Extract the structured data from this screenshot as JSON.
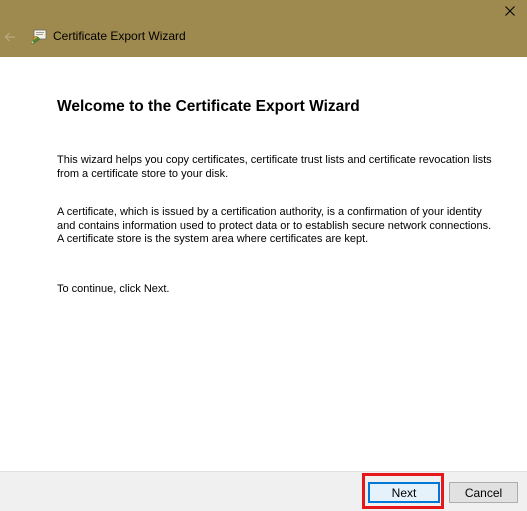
{
  "window": {
    "title": "Certificate Export Wizard",
    "titlebar_color": "#9e8a4f"
  },
  "icons": {
    "close": "close-icon",
    "back": "back-arrow-icon",
    "wizard": "certificate-wizard-icon"
  },
  "content": {
    "heading": "Welcome to the Certificate Export Wizard",
    "paragraph_1": "This wizard helps you copy certificates, certificate trust lists and certificate revocation lists from a certificate store to your disk.",
    "paragraph_2": "A certificate, which is issued by a certification authority, is a confirmation of your identity and contains information used to protect data or to establish secure network connections. A certificate store is the system area where certificates are kept.",
    "paragraph_3": "To continue, click Next."
  },
  "footer": {
    "next_label": "Next",
    "cancel_label": "Cancel",
    "highlight_color": "#e4171b"
  }
}
